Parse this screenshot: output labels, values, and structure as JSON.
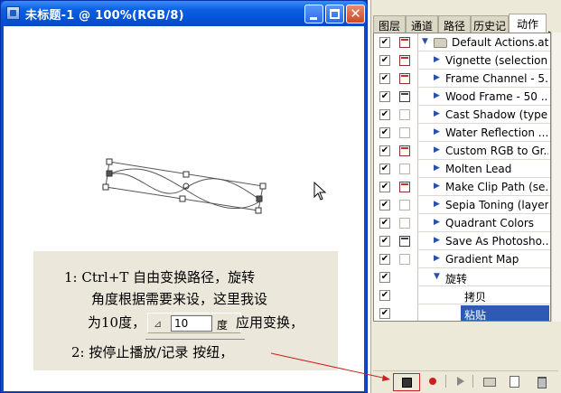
{
  "document": {
    "title": "未标题-1 @ 100%(RGB/8)",
    "close_glyph": "✕"
  },
  "note": {
    "line1": "1: Ctrl+T 自由变换路径，旋转",
    "line2": "角度根据需要来设，这里我设",
    "line3a": "为10度，",
    "angle_icon": "⊿",
    "angle_value": "10",
    "angle_unit": "度",
    "line3b": "应用变换，",
    "line4": "2: 按停止播放/记录 按纽，"
  },
  "panel": {
    "tabs": [
      {
        "label": "图层",
        "active": false
      },
      {
        "label": "通道",
        "active": false
      },
      {
        "label": "路径",
        "active": false
      },
      {
        "label": "历史记",
        "active": false
      },
      {
        "label": "动作",
        "active": true
      }
    ],
    "menu_arrow": "▶",
    "rows": [
      {
        "label": "Default Actions.atn",
        "check": "✔",
        "dialog": "on",
        "level": 0,
        "expander": "▼",
        "folder": true
      },
      {
        "label": "Vignette (selection)",
        "check": "✔",
        "dialog": "on",
        "level": 1,
        "expander": "▶"
      },
      {
        "label": "Frame Channel - 5...",
        "check": "✔",
        "dialog": "on",
        "level": 1,
        "expander": "▶"
      },
      {
        "label": "Wood Frame - 50 ...",
        "check": "✔",
        "dialog": "dark",
        "level": 1,
        "expander": "▶"
      },
      {
        "label": "Cast Shadow (type)",
        "check": "✔",
        "dialog": "off",
        "level": 1,
        "expander": "▶"
      },
      {
        "label": "Water Reflection ...",
        "check": "✔",
        "dialog": "off",
        "level": 1,
        "expander": "▶"
      },
      {
        "label": "Custom RGB to Gr...",
        "check": "✔",
        "dialog": "on",
        "level": 1,
        "expander": "▶"
      },
      {
        "label": "Molten Lead",
        "check": "✔",
        "dialog": "off",
        "level": 1,
        "expander": "▶"
      },
      {
        "label": "Make Clip Path (se...",
        "check": "✔",
        "dialog": "on",
        "level": 1,
        "expander": "▶"
      },
      {
        "label": "Sepia Toning (layer)",
        "check": "✔",
        "dialog": "off",
        "level": 1,
        "expander": "▶"
      },
      {
        "label": "Quadrant Colors",
        "check": "✔",
        "dialog": "off",
        "level": 1,
        "expander": "▶"
      },
      {
        "label": "Save As Photosho...",
        "check": "✔",
        "dialog": "dark",
        "level": 1,
        "expander": "▶"
      },
      {
        "label": "Gradient Map",
        "check": "✔",
        "dialog": "off",
        "level": 1,
        "expander": "▶"
      },
      {
        "label": "旋转",
        "check": "✔",
        "dialog": "none",
        "level": 1,
        "expander": "▼"
      },
      {
        "label": "拷贝",
        "check": "✔",
        "dialog": "none",
        "level": 2,
        "expander": ""
      },
      {
        "label": "粘贴",
        "check": "✔",
        "dialog": "none",
        "level": 2,
        "expander": "",
        "selected": true
      }
    ]
  },
  "colors": {
    "titlebar": "#0553d8",
    "selection": "#2d5bb3",
    "annotation_arrow": "#cc2222",
    "note_background": "#ebe7da"
  }
}
